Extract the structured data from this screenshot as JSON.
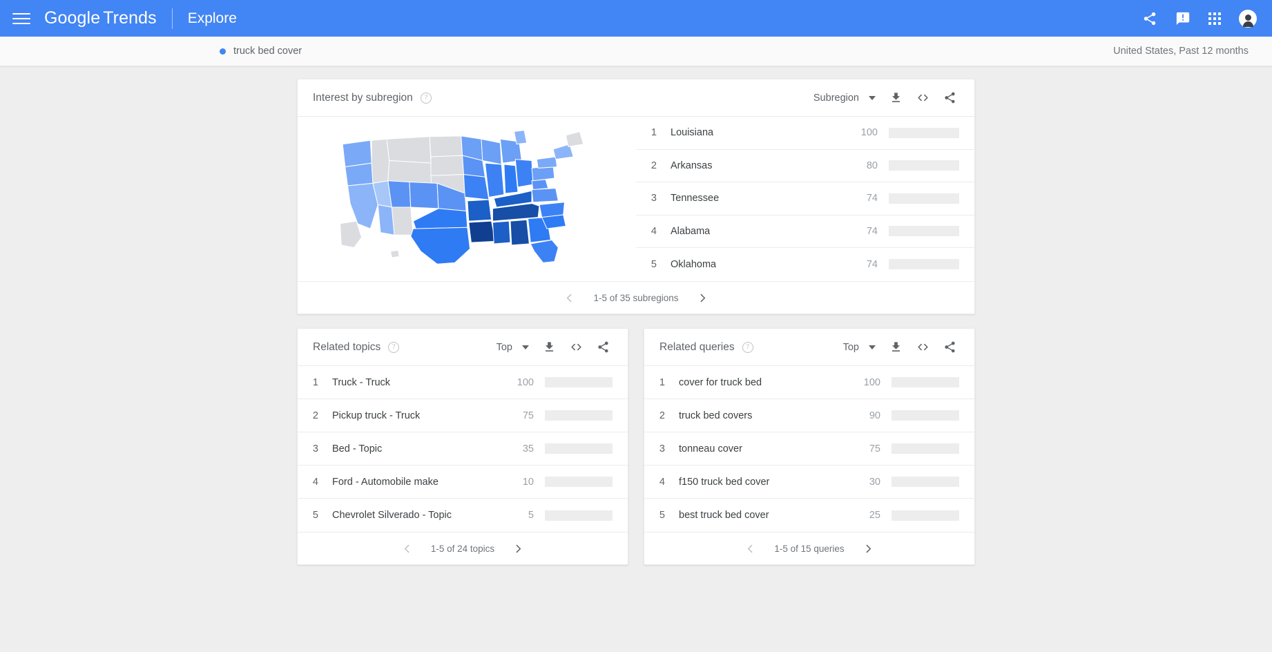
{
  "appbar": {
    "menu_icon": "hamburger-menu-icon",
    "brand_google": "Google",
    "brand_trends": "Trends",
    "explore_label": "Explore",
    "share_icon": "share-icon",
    "feedback_icon": "feedback-icon",
    "apps_icon": "apps-grid-icon",
    "account_icon": "account-avatar-icon",
    "bg_color": "#4285f4"
  },
  "querybar": {
    "term": "truck bed cover",
    "term_dot_color": "#4285f4",
    "geo_time": "United States, Past 12 months"
  },
  "subregion": {
    "title": "Interest by subregion",
    "help_icon": "help-circle-icon",
    "selector_label": "Subregion",
    "download_icon": "download-icon",
    "embed_icon": "embed-code-icon",
    "share_icon": "share-icon",
    "pagination": "1-5 of 35 subregions",
    "prev_icon": "chevron-left-icon",
    "next_icon": "chevron-right-icon"
  },
  "topics": {
    "title": "Related topics",
    "help_icon": "help-circle-icon",
    "selector_label": "Top",
    "download_icon": "download-icon",
    "embed_icon": "embed-code-icon",
    "share_icon": "share-icon",
    "pagination": "1-5 of 24 topics",
    "prev_icon": "chevron-left-icon",
    "next_icon": "chevron-right-icon"
  },
  "queries": {
    "title": "Related queries",
    "help_icon": "help-circle-icon",
    "selector_label": "Top",
    "download_icon": "download-icon",
    "embed_icon": "embed-code-icon",
    "share_icon": "share-icon",
    "pagination": "1-5 of 15 queries",
    "prev_icon": "chevron-left-icon",
    "next_icon": "chevron-right-icon"
  },
  "chart_data": [
    {
      "type": "bar",
      "title": "Interest by subregion",
      "xlabel": "",
      "ylabel": "",
      "ylim": [
        0,
        100
      ],
      "accent_color": "#4285f4",
      "track_color": "#ededed",
      "categories": [
        "Louisiana",
        "Arkansas",
        "Tennessee",
        "Alabama",
        "Oklahoma"
      ],
      "values": [
        100,
        80,
        74,
        74,
        74
      ],
      "ranks": [
        "1",
        "2",
        "3",
        "4",
        "5"
      ]
    },
    {
      "type": "bar",
      "title": "Related topics",
      "xlabel": "",
      "ylabel": "",
      "ylim": [
        0,
        100
      ],
      "accent_color": "#4285f4",
      "track_color": "#ededed",
      "categories": [
        "Truck - Truck",
        "Pickup truck - Truck",
        "Bed - Topic",
        "Ford - Automobile make",
        "Chevrolet Silverado - Topic"
      ],
      "values": [
        100,
        75,
        35,
        10,
        5
      ],
      "ranks": [
        "1",
        "2",
        "3",
        "4",
        "5"
      ]
    },
    {
      "type": "bar",
      "title": "Related queries",
      "xlabel": "",
      "ylabel": "",
      "ylim": [
        0,
        100
      ],
      "accent_color": "#4285f4",
      "track_color": "#ededed",
      "categories": [
        "cover for truck bed",
        "truck bed covers",
        "tonneau cover",
        "f150 truck bed cover",
        "best truck bed cover"
      ],
      "values": [
        100,
        90,
        75,
        30,
        25
      ],
      "ranks": [
        "1",
        "2",
        "3",
        "4",
        "5"
      ]
    },
    {
      "type": "heatmap",
      "title": "United States choropleth map of search interest",
      "no_data_color": "#dadce0",
      "scale_low": "#c6dafc",
      "scale_high": "#174ea6"
    }
  ]
}
